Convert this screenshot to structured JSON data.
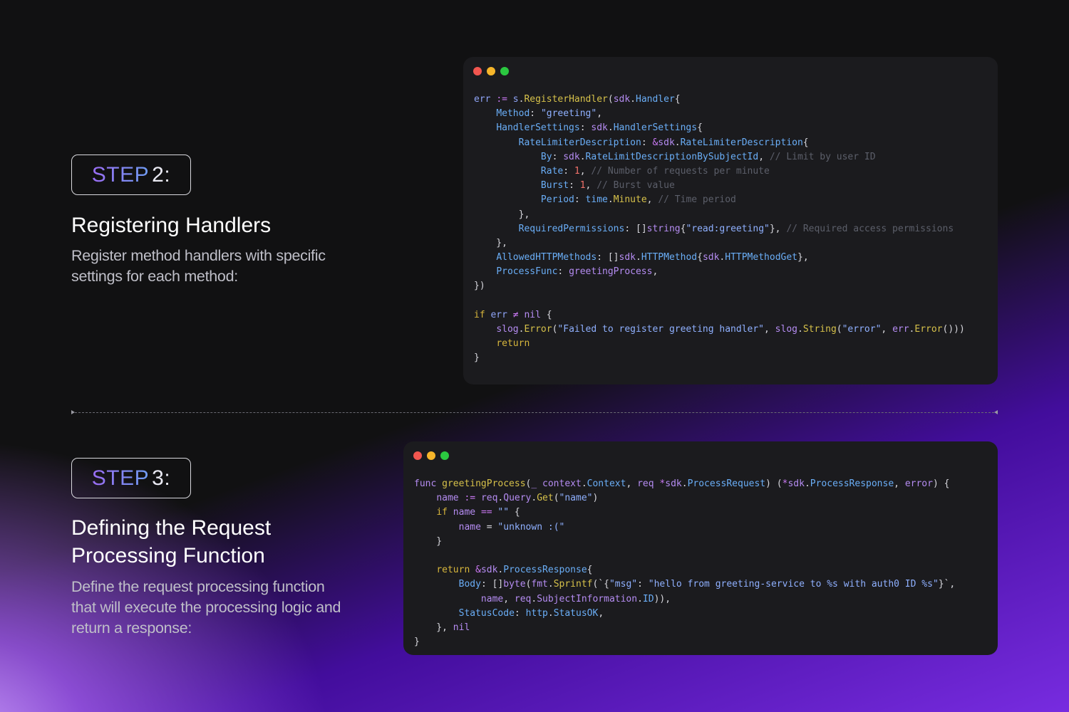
{
  "colors": {
    "background": "#111112",
    "accent_purple": "#7b2ff0",
    "code_window_bg": "#1b1b1e",
    "step_gradient_start": "#9a6cf3",
    "step_gradient_end": "#6f9cf2"
  },
  "window_controls": [
    "close-dot",
    "minimize-dot",
    "maximize-dot"
  ],
  "step2": {
    "badge_word": "STEP",
    "badge_number": "2:",
    "title": "Registering Handlers",
    "description": "Register method handlers with specific settings for each method:",
    "code_lines": [
      [
        [
          "t-id",
          "err"
        ],
        [
          "t-pl",
          " "
        ],
        [
          "t-op",
          ":="
        ],
        [
          "t-pl",
          " "
        ],
        [
          "t-id",
          "s"
        ],
        [
          "t-pl",
          "."
        ],
        [
          "t-fn",
          "RegisterHandler"
        ],
        [
          "t-pl",
          "("
        ],
        [
          "t-pkg",
          "sdk"
        ],
        [
          "t-pl",
          "."
        ],
        [
          "t-field",
          "Handler"
        ],
        [
          "t-pl",
          "{"
        ]
      ],
      [
        [
          "t-pl",
          "    "
        ],
        [
          "t-field",
          "Method"
        ],
        [
          "t-pl",
          ": "
        ],
        [
          "t-str",
          "\"greeting\""
        ],
        [
          "t-pl",
          ","
        ]
      ],
      [
        [
          "t-pl",
          "    "
        ],
        [
          "t-field",
          "HandlerSettings"
        ],
        [
          "t-pl",
          ": "
        ],
        [
          "t-pkg",
          "sdk"
        ],
        [
          "t-pl",
          "."
        ],
        [
          "t-field",
          "HandlerSettings"
        ],
        [
          "t-pl",
          "{"
        ]
      ],
      [
        [
          "t-pl",
          "        "
        ],
        [
          "t-field",
          "RateLimiterDescription"
        ],
        [
          "t-pl",
          ": "
        ],
        [
          "t-op",
          "&"
        ],
        [
          "t-pkg",
          "sdk"
        ],
        [
          "t-pl",
          "."
        ],
        [
          "t-field",
          "RateLimiterDescription"
        ],
        [
          "t-pl",
          "{"
        ]
      ],
      [
        [
          "t-pl",
          "            "
        ],
        [
          "t-field",
          "By"
        ],
        [
          "t-pl",
          ": "
        ],
        [
          "t-pkg",
          "sdk"
        ],
        [
          "t-pl",
          "."
        ],
        [
          "t-field",
          "RateLimitDescriptionBySubjectId"
        ],
        [
          "t-pl",
          ", "
        ],
        [
          "t-cm",
          "// Limit by user ID"
        ]
      ],
      [
        [
          "t-pl",
          "            "
        ],
        [
          "t-field",
          "Rate"
        ],
        [
          "t-pl",
          ": "
        ],
        [
          "t-num",
          "1"
        ],
        [
          "t-pl",
          ", "
        ],
        [
          "t-cm",
          "// Number of requests per minute"
        ]
      ],
      [
        [
          "t-pl",
          "            "
        ],
        [
          "t-field",
          "Burst"
        ],
        [
          "t-pl",
          ": "
        ],
        [
          "t-num",
          "1"
        ],
        [
          "t-pl",
          ", "
        ],
        [
          "t-cm",
          "// Burst value"
        ]
      ],
      [
        [
          "t-pl",
          "            "
        ],
        [
          "t-field",
          "Period"
        ],
        [
          "t-pl",
          ": "
        ],
        [
          "t-field",
          "time"
        ],
        [
          "t-pl",
          "."
        ],
        [
          "t-fn",
          "Minute"
        ],
        [
          "t-pl",
          ", "
        ],
        [
          "t-cm",
          "// Time period"
        ]
      ],
      [
        [
          "t-pl",
          "        },"
        ]
      ],
      [
        [
          "t-pl",
          "        "
        ],
        [
          "t-field",
          "RequiredPermissions"
        ],
        [
          "t-pl",
          ": []"
        ],
        [
          "t-pkg",
          "string"
        ],
        [
          "t-pl",
          "{"
        ],
        [
          "t-str",
          "\"read:greeting\""
        ],
        [
          "t-pl",
          "}, "
        ],
        [
          "t-cm",
          "// Required access permissions"
        ]
      ],
      [
        [
          "t-pl",
          "    },"
        ]
      ],
      [
        [
          "t-pl",
          "    "
        ],
        [
          "t-field",
          "AllowedHTTPMethods"
        ],
        [
          "t-pl",
          ": []"
        ],
        [
          "t-pkg",
          "sdk"
        ],
        [
          "t-pl",
          "."
        ],
        [
          "t-field",
          "HTTPMethod"
        ],
        [
          "t-pl",
          "{"
        ],
        [
          "t-pkg",
          "sdk"
        ],
        [
          "t-pl",
          "."
        ],
        [
          "t-field",
          "HTTPMethodGet"
        ],
        [
          "t-pl",
          "},"
        ]
      ],
      [
        [
          "t-pl",
          "    "
        ],
        [
          "t-field",
          "ProcessFunc"
        ],
        [
          "t-pl",
          ": "
        ],
        [
          "t-pkg",
          "greetingProcess"
        ],
        [
          "t-pl",
          ","
        ]
      ],
      [
        [
          "t-pl",
          "})"
        ]
      ],
      [
        [
          "t-pl",
          ""
        ]
      ],
      [
        [
          "t-kw",
          "if"
        ],
        [
          "t-pl",
          " "
        ],
        [
          "t-id",
          "err"
        ],
        [
          "t-pl",
          " "
        ],
        [
          "t-op",
          "≠"
        ],
        [
          "t-pl",
          " "
        ],
        [
          "t-pkg",
          "nil"
        ],
        [
          "t-pl",
          " {"
        ]
      ],
      [
        [
          "t-pl",
          "    "
        ],
        [
          "t-pkg",
          "slog"
        ],
        [
          "t-pl",
          "."
        ],
        [
          "t-fn",
          "Error"
        ],
        [
          "t-pl",
          "("
        ],
        [
          "t-str",
          "\"Failed to register greeting handler\""
        ],
        [
          "t-pl",
          ", "
        ],
        [
          "t-pkg",
          "slog"
        ],
        [
          "t-pl",
          "."
        ],
        [
          "t-fn",
          "String"
        ],
        [
          "t-pl",
          "("
        ],
        [
          "t-str",
          "\"error\""
        ],
        [
          "t-pl",
          ", "
        ],
        [
          "t-pkg",
          "err"
        ],
        [
          "t-pl",
          "."
        ],
        [
          "t-fn",
          "Error"
        ],
        [
          "t-pl",
          "()))"
        ]
      ],
      [
        [
          "t-pl",
          "    "
        ],
        [
          "t-kw",
          "return"
        ]
      ],
      [
        [
          "t-pl",
          "}"
        ]
      ]
    ]
  },
  "step3": {
    "badge_word": "STEP",
    "badge_number": "3:",
    "title": "Defining the Request Processing Function",
    "description": "Define the request processing function that will execute the processing logic and return a response:",
    "code_lines": [
      [
        [
          "t-pkg",
          "func"
        ],
        [
          "t-pl",
          " "
        ],
        [
          "t-fn",
          "greetingProcess"
        ],
        [
          "t-pl",
          "("
        ],
        [
          "t-pkg",
          "_"
        ],
        [
          "t-pl",
          " "
        ],
        [
          "t-pkg",
          "context"
        ],
        [
          "t-pl",
          "."
        ],
        [
          "t-field",
          "Context"
        ],
        [
          "t-pl",
          ", "
        ],
        [
          "t-pkg",
          "req"
        ],
        [
          "t-pl",
          " "
        ],
        [
          "t-op",
          "*"
        ],
        [
          "t-pkg",
          "sdk"
        ],
        [
          "t-pl",
          "."
        ],
        [
          "t-field",
          "ProcessRequest"
        ],
        [
          "t-pl",
          ") ("
        ],
        [
          "t-op",
          "*"
        ],
        [
          "t-pkg",
          "sdk"
        ],
        [
          "t-pl",
          "."
        ],
        [
          "t-field",
          "ProcessResponse"
        ],
        [
          "t-pl",
          ", "
        ],
        [
          "t-pkg",
          "error"
        ],
        [
          "t-pl",
          ") {"
        ]
      ],
      [
        [
          "t-pl",
          "    "
        ],
        [
          "t-pkg",
          "name"
        ],
        [
          "t-pl",
          " "
        ],
        [
          "t-op",
          ":="
        ],
        [
          "t-pl",
          " "
        ],
        [
          "t-pkg",
          "req"
        ],
        [
          "t-pl",
          "."
        ],
        [
          "t-pkg",
          "Query"
        ],
        [
          "t-pl",
          "."
        ],
        [
          "t-fn",
          "Get"
        ],
        [
          "t-pl",
          "("
        ],
        [
          "t-str",
          "\"name\""
        ],
        [
          "t-pl",
          ")"
        ]
      ],
      [
        [
          "t-pl",
          "    "
        ],
        [
          "t-kw",
          "if"
        ],
        [
          "t-pl",
          " "
        ],
        [
          "t-pkg",
          "name"
        ],
        [
          "t-pl",
          " "
        ],
        [
          "t-op",
          "=="
        ],
        [
          "t-pl",
          " "
        ],
        [
          "t-str",
          "\"\""
        ],
        [
          "t-pl",
          " {"
        ]
      ],
      [
        [
          "t-pl",
          "        "
        ],
        [
          "t-pkg",
          "name"
        ],
        [
          "t-pl",
          " = "
        ],
        [
          "t-str",
          "\"unknown :(\""
        ]
      ],
      [
        [
          "t-pl",
          "    }"
        ]
      ],
      [
        [
          "t-pl",
          ""
        ]
      ],
      [
        [
          "t-pl",
          "    "
        ],
        [
          "t-kw",
          "return"
        ],
        [
          "t-pl",
          " "
        ],
        [
          "t-op",
          "&"
        ],
        [
          "t-pkg",
          "sdk"
        ],
        [
          "t-pl",
          "."
        ],
        [
          "t-field",
          "ProcessResponse"
        ],
        [
          "t-pl",
          "{"
        ]
      ],
      [
        [
          "t-pl",
          "        "
        ],
        [
          "t-field",
          "Body"
        ],
        [
          "t-pl",
          ": []"
        ],
        [
          "t-pkg",
          "byte"
        ],
        [
          "t-pl",
          "("
        ],
        [
          "t-pkg",
          "fmt"
        ],
        [
          "t-pl",
          "."
        ],
        [
          "t-fn",
          "Sprintf"
        ],
        [
          "t-pl",
          "(`{"
        ],
        [
          "t-str",
          "\"msg\""
        ],
        [
          "t-pl",
          ": "
        ],
        [
          "t-str",
          "\"hello from greeting-service to %s with auth0 ID %s\""
        ],
        [
          "t-pl",
          "}`,"
        ]
      ],
      [
        [
          "t-pl",
          "            "
        ],
        [
          "t-pkg",
          "name"
        ],
        [
          "t-pl",
          ", "
        ],
        [
          "t-pkg",
          "req"
        ],
        [
          "t-pl",
          "."
        ],
        [
          "t-pkg",
          "SubjectInformation"
        ],
        [
          "t-pl",
          "."
        ],
        [
          "t-field",
          "ID"
        ],
        [
          "t-pl",
          ")),"
        ]
      ],
      [
        [
          "t-pl",
          "        "
        ],
        [
          "t-field",
          "StatusCode"
        ],
        [
          "t-pl",
          ": "
        ],
        [
          "t-field",
          "http"
        ],
        [
          "t-pl",
          "."
        ],
        [
          "t-field",
          "StatusOK"
        ],
        [
          "t-pl",
          ","
        ]
      ],
      [
        [
          "t-pl",
          "    }, "
        ],
        [
          "t-pkg",
          "nil"
        ]
      ],
      [
        [
          "t-pl",
          "}"
        ]
      ]
    ]
  }
}
